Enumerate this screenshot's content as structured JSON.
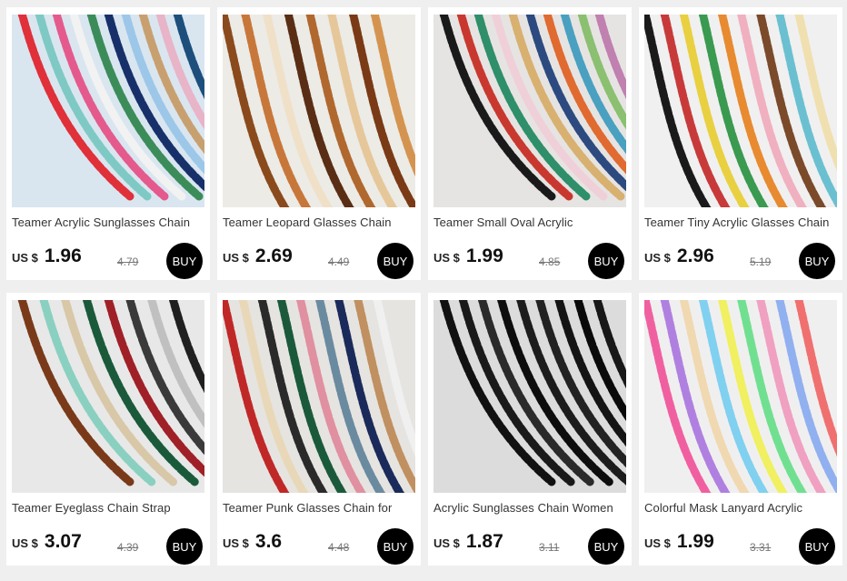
{
  "products": [
    {
      "title": "Teamer Acrylic Sunglasses Chain",
      "currency": "US $",
      "price": "1.96",
      "old_price": "4.79",
      "buy_label": "BUY",
      "image": {
        "bg": "#d9e6f0",
        "colors": [
          "#e0303a",
          "#7fc9c4",
          "#e55a8c",
          "#f2f2f2",
          "#3c8c5a",
          "#18306a",
          "#9cc7e8",
          "#c8a070",
          "#e8b4c8",
          "#1d4f7c"
        ]
      }
    },
    {
      "title": "Teamer Leopard Glasses Chain",
      "currency": "US $",
      "price": "2.69",
      "old_price": "4.49",
      "buy_label": "BUY",
      "image": {
        "bg": "#ecebe6",
        "colors": [
          "#8b4a1c",
          "#c8773a",
          "#f0e0c8",
          "#5a2e14",
          "#b0682e",
          "#e6c79a",
          "#7a3a16",
          "#d49450"
        ]
      }
    },
    {
      "title": "Teamer Small Oval Acrylic",
      "currency": "US $",
      "price": "1.99",
      "old_price": "4.85",
      "buy_label": "BUY",
      "image": {
        "bg": "#e6e4e2",
        "colors": [
          "#1a1a1a",
          "#c9382e",
          "#2e8f6a",
          "#f0d0d8",
          "#d8b070",
          "#2c4a80",
          "#e06a30",
          "#4aa0c0",
          "#8ac070",
          "#c080b0"
        ]
      }
    },
    {
      "title": "Teamer Tiny Acrylic Glasses Chain",
      "currency": "US $",
      "price": "2.96",
      "old_price": "5.19",
      "buy_label": "BUY",
      "image": {
        "bg": "#f0f0f0",
        "colors": [
          "#1a1a1a",
          "#c83a3a",
          "#e8d040",
          "#3a9a50",
          "#e88a30",
          "#f0b0c0",
          "#7a4a2a",
          "#6ac0d0",
          "#f0e0b0"
        ]
      }
    },
    {
      "title": "Teamer Eyeglass Chain Strap",
      "currency": "US $",
      "price": "3.07",
      "old_price": "4.39",
      "buy_label": "BUY",
      "image": {
        "bg": "#e8e8e8",
        "colors": [
          "#7a3a1a",
          "#8ad0c0",
          "#d8c8a8",
          "#1a5a3a",
          "#a02028",
          "#3a3a3a",
          "#c0c0c0",
          "#202020"
        ]
      }
    },
    {
      "title": "Teamer Punk Glasses Chain for",
      "currency": "US $",
      "price": "3.6",
      "old_price": "4.48",
      "buy_label": "BUY",
      "image": {
        "bg": "#e6e4e0",
        "colors": [
          "#c02828",
          "#e8d8b8",
          "#2a2a2a",
          "#1a5a3a",
          "#e090a0",
          "#6a8aa0",
          "#1a2a5a",
          "#c09060",
          "#f0f0f0"
        ]
      }
    },
    {
      "title": "Acrylic Sunglasses Chain Women",
      "currency": "US $",
      "price": "1.87",
      "old_price": "3.11",
      "buy_label": "BUY",
      "image": {
        "bg": "#dcdcdc",
        "colors": [
          "#111111",
          "#1a1a1a",
          "#2a2a2a",
          "#0d0d0d",
          "#1c1c1c",
          "#222222",
          "#141414",
          "#0a0a0a",
          "#181818"
        ]
      }
    },
    {
      "title": "Colorful Mask Lanyard Acrylic",
      "currency": "US $",
      "price": "1.99",
      "old_price": "3.31",
      "buy_label": "BUY",
      "image": {
        "bg": "#f0eff0",
        "colors": [
          "#f060a0",
          "#b080e0",
          "#f0d8b0",
          "#80d0f0",
          "#f0f060",
          "#70e090",
          "#f0a0c0",
          "#90b0f0",
          "#f07070"
        ]
      }
    }
  ]
}
